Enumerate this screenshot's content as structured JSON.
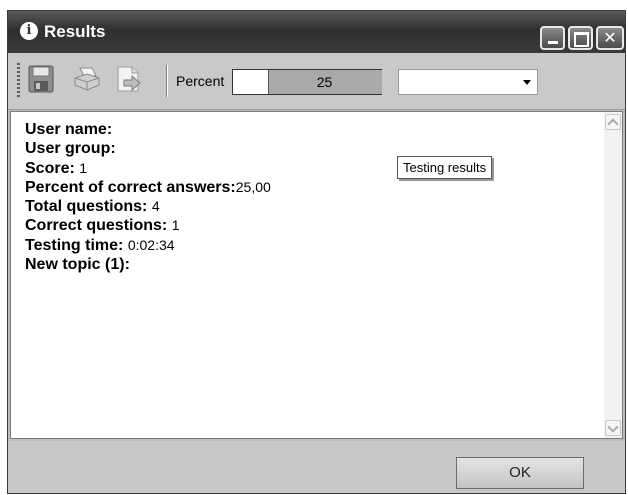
{
  "window": {
    "title": "Results",
    "title_icon": "info-icon",
    "buttons": [
      "minimize-icon",
      "maximize-icon",
      "close-icon"
    ]
  },
  "toolbar": {
    "icons": [
      "save-icon",
      "print-icon",
      "export-icon"
    ],
    "percent_label": "Percent",
    "percent_value": "25",
    "percent_fraction": 0.25,
    "dropdown_value": ""
  },
  "results": {
    "user_name_label": "User name:",
    "user_name_value": "",
    "user_group_label": "User group:",
    "user_group_value": "",
    "score_label": "Score:",
    "score_value": "1",
    "percent_correct_label": "Percent of correct answers:",
    "percent_correct_value": "25,00",
    "total_questions_label": "Total questions:",
    "total_questions_value": "4",
    "correct_questions_label": "Correct questions:",
    "correct_questions_value": "1",
    "testing_time_label": "Testing time:",
    "testing_time_value": "0:02:34",
    "topic_label": "New topic (1):"
  },
  "tooltip": "Testing results",
  "footer": {
    "ok_label": "OK"
  },
  "colors": {
    "titlebar": "#3a3a3a",
    "toolbar": "#c9c9c9",
    "content_bg": "#ffffff",
    "percent_fill": "#a9a9a9"
  }
}
